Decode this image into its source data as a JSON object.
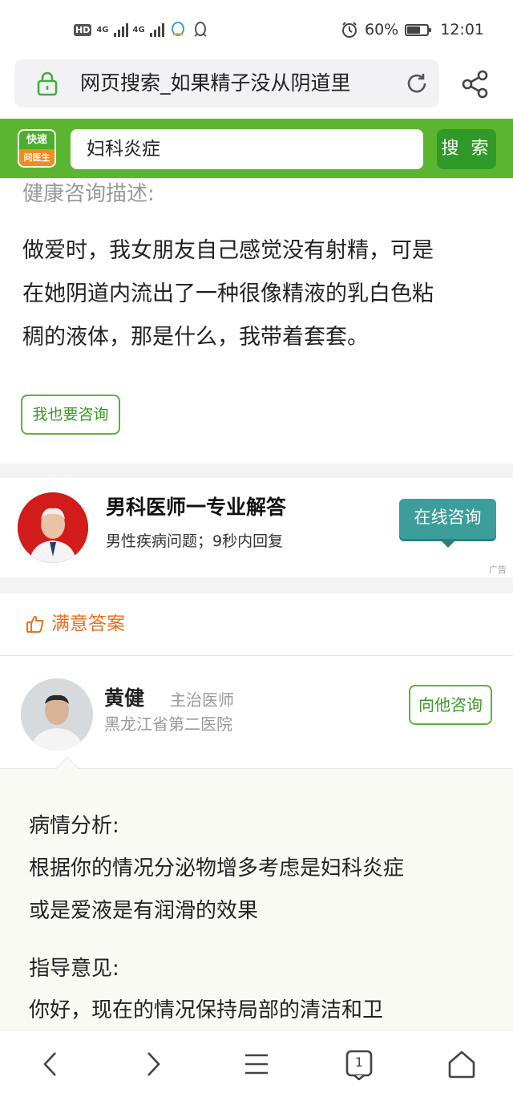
{
  "status_bar": {
    "left_badges": [
      "HD",
      "4G",
      "4G"
    ],
    "battery_percent": "60%",
    "battery_level": 0.6,
    "time": "12:01"
  },
  "browser": {
    "address_text": "网页搜索_如果精子没从阴道里"
  },
  "site_header": {
    "logo_top": "快速",
    "logo_bottom": "问医生",
    "search_value": "妇科炎症",
    "search_button": "搜 索"
  },
  "question": {
    "label": "健康咨询描述:",
    "lines": [
      "做爱时，我女朋友自己感觉没有射精，可是",
      "在她阴道内流出了一种很像精液的乳白色粘",
      "稠的液体，那是什么，我带着套套。"
    ],
    "consult_button": "我也要咨询"
  },
  "ad": {
    "title": "男科医师一专业解答",
    "subtitle": "男性疾病问题；9秒内回复",
    "button": "在线咨询",
    "tag": "广告"
  },
  "answer_header": {
    "label": "满意答案"
  },
  "doctor": {
    "name": "黄健",
    "title": "主治医师",
    "hospital": "黑龙江省第二医院",
    "ask_button": "向他咨询"
  },
  "answer": {
    "analysis_label": "病情分析:",
    "analysis_lines": [
      "根据你的情况分泌物增多考虑是妇科炎症",
      "或是爱液是有润滑的效果"
    ],
    "guidance_label": "指导意见:",
    "guidance_lines": [
      "你好，现在的情况保持局部的清洁和卫"
    ]
  },
  "bottom_nav": {
    "tab_count": "1"
  },
  "colors": {
    "brand_green": "#5cb531",
    "dark_green": "#2f9a27",
    "teal": "#3c9e9a",
    "orange": "#e8711e"
  }
}
